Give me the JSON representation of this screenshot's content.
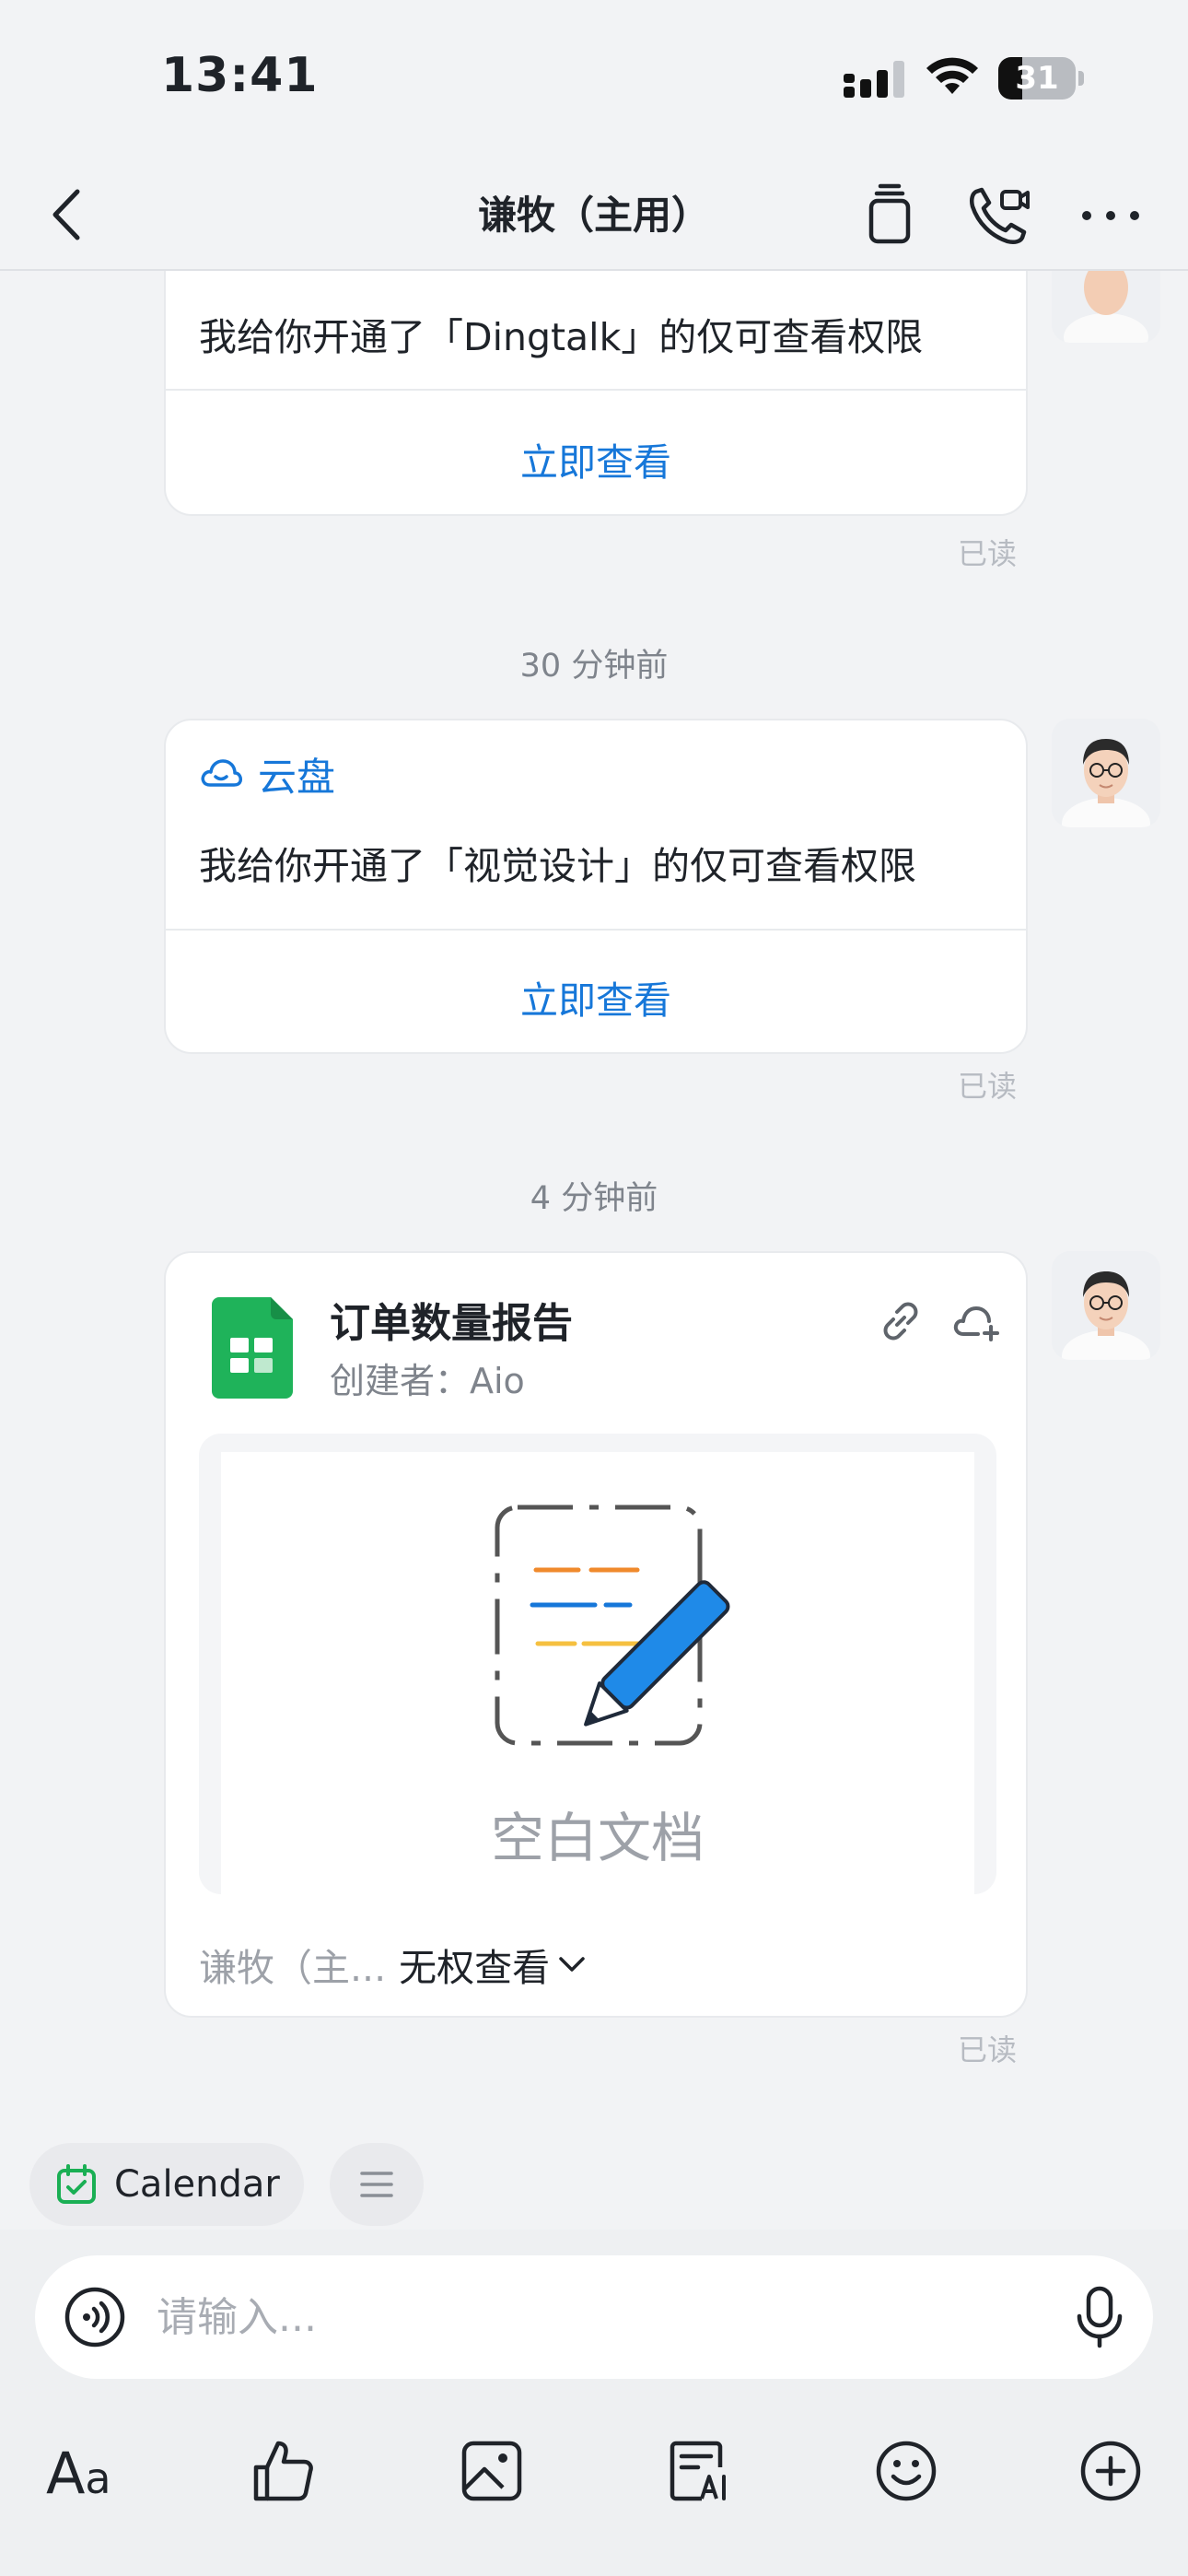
{
  "status_bar": {
    "time": "13:41",
    "battery": {
      "percent": 31,
      "label": "31"
    }
  },
  "nav": {
    "title": "谦牧（主用）"
  },
  "messages": [
    {
      "text": "我给你开通了「Dingtalk」的仅可查看权限",
      "action": "立即查看",
      "read": "已读"
    },
    {
      "timestamp": "30 分钟前",
      "source": "云盘",
      "text": "我给你开通了「视觉设计」的仅可查看权限",
      "action": "立即查看",
      "read": "已读"
    },
    {
      "timestamp": "4 分钟前",
      "doc": {
        "title": "订单数量报告",
        "creator": "创建者：Aio",
        "preview_label": "空白文档",
        "permission_sender": "谦牧（主...",
        "permission_value": "无权查看"
      },
      "read": "已读"
    }
  ],
  "quick_chips": {
    "calendar": "Calendar"
  },
  "input": {
    "placeholder": "请输入..."
  },
  "toolbar": {
    "font_label_big": "A",
    "font_label_small": "a"
  },
  "colors": {
    "accent": "#1677d9",
    "sheet_green": "#1fb35a",
    "calendar_green": "#1aaf54"
  }
}
